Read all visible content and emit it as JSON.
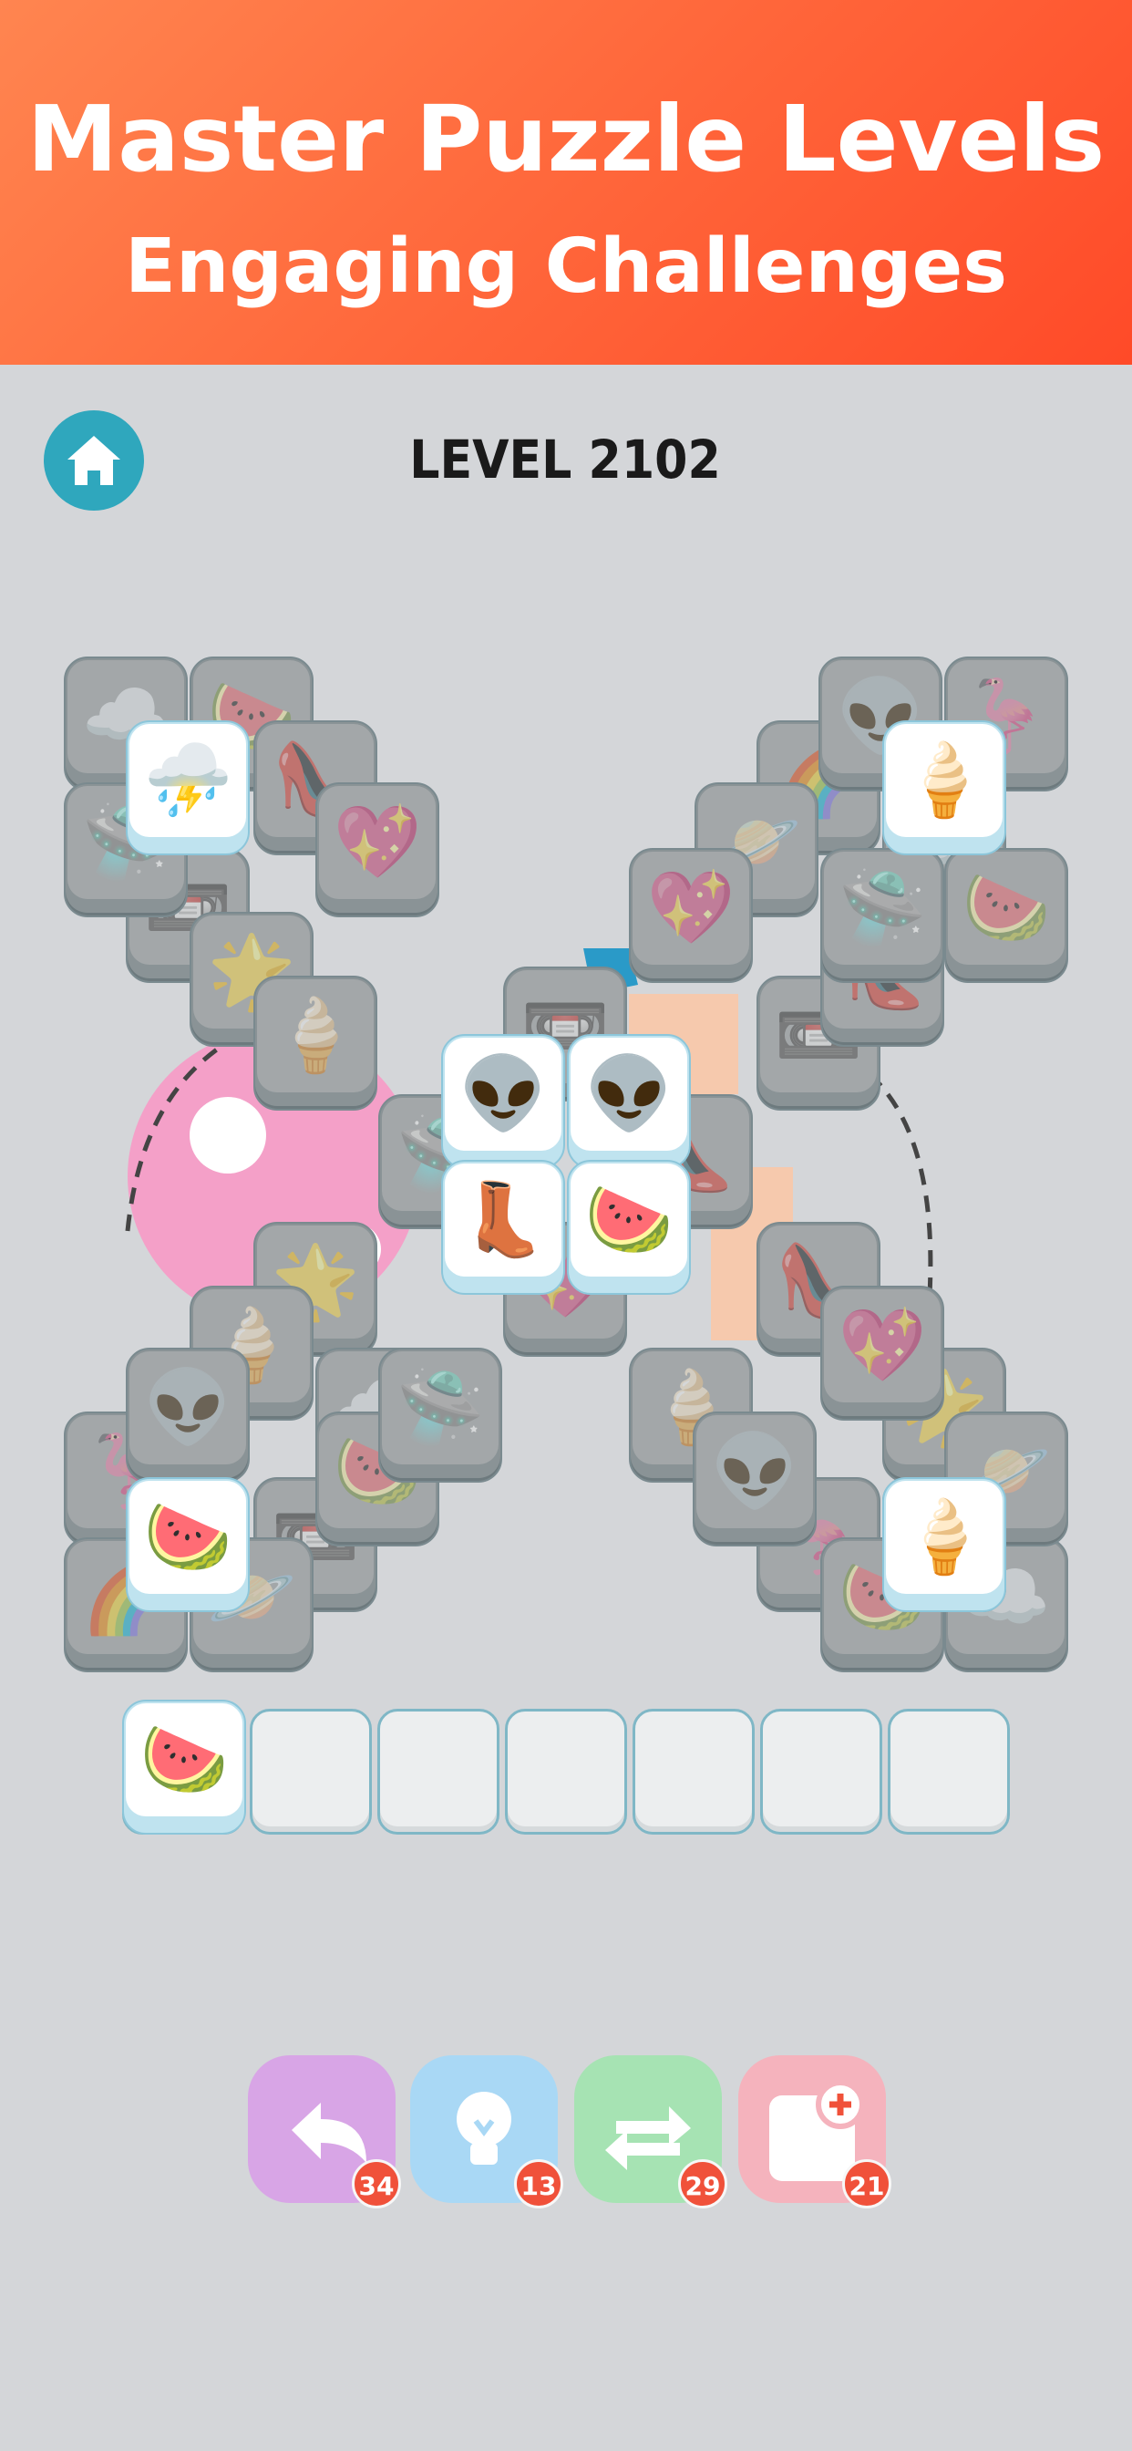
{
  "banner": {
    "title": "Master Puzzle Levels",
    "subtitle": "Engaging Challenges"
  },
  "header": {
    "level_label": "LEVEL 2102",
    "home_icon": "home-icon"
  },
  "colors": {
    "banner_start": "#ff8550",
    "banner_end": "#ff4a28",
    "home_button": "#2fa7bd",
    "badge": "#f0513a"
  },
  "tiles": [
    {
      "icon": "cloud-icon",
      "glyph": "☁️",
      "state": "dim"
    },
    {
      "icon": "watermelon-icon",
      "glyph": "🍉",
      "state": "dim"
    },
    {
      "icon": "cloud-icon",
      "glyph": "⛈️",
      "state": "lit"
    },
    {
      "icon": "ice-cream-icon",
      "glyph": "🍦",
      "state": "dim"
    },
    {
      "icon": "heart-icon",
      "glyph": "💖",
      "state": "dim"
    },
    {
      "icon": "ice-cream-icon",
      "glyph": "🍦",
      "state": "lit"
    },
    {
      "icon": "alien-icon",
      "glyph": "👽",
      "state": "lit"
    },
    {
      "icon": "alien-icon",
      "glyph": "👽",
      "state": "lit"
    },
    {
      "icon": "boot-icon",
      "glyph": "👢",
      "state": "lit"
    },
    {
      "icon": "watermelon-icon",
      "glyph": "🍉",
      "state": "lit"
    },
    {
      "icon": "watermelon-icon",
      "glyph": "🍉",
      "state": "lit"
    },
    {
      "icon": "ice-cream-icon",
      "glyph": "🍦",
      "state": "lit"
    }
  ],
  "slot_bar": {
    "filled": [
      {
        "icon": "watermelon-icon",
        "glyph": "🍉"
      }
    ],
    "total_slots": 7
  },
  "tools": [
    {
      "name": "undo",
      "icon": "undo-arrow-icon",
      "count": "34",
      "color": "#d8a5e6"
    },
    {
      "name": "hint",
      "icon": "lightbulb-icon",
      "count": "13",
      "color": "#a9d8f5"
    },
    {
      "name": "shuffle",
      "icon": "shuffle-icon",
      "count": "29",
      "color": "#a6e3b3"
    },
    {
      "name": "add-slot",
      "icon": "add-slot-icon",
      "count": "21",
      "color": "#f5b3bd"
    }
  ]
}
